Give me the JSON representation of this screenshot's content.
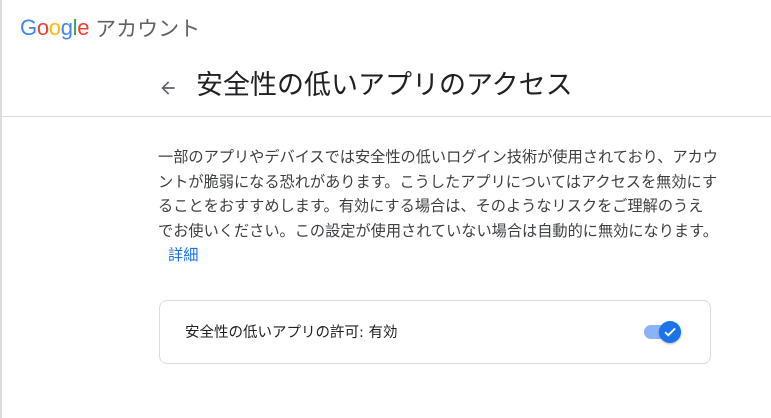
{
  "brand": {
    "letters": [
      {
        "char": "G",
        "color": "#4285F4"
      },
      {
        "char": "o",
        "color": "#EA4335"
      },
      {
        "char": "o",
        "color": "#FBBC05"
      },
      {
        "char": "g",
        "color": "#4285F4"
      },
      {
        "char": "l",
        "color": "#34A853"
      },
      {
        "char": "e",
        "color": "#EA4335"
      }
    ],
    "product": "アカウント"
  },
  "header": {
    "back_icon": "arrow-back-icon",
    "title": "安全性の低いアプリのアクセス"
  },
  "description": {
    "text": "一部のアプリやデバイスでは安全性の低いログイン技術が使用されており、アカウントが脆弱になる恐れがあります。こうしたアプリについてはアクセスを無効にすることをおすすめします。有効にする場合は、そのようなリスクをご理解のうえでお使いください。この設定が使用されていない場合は自動的に無効になります。",
    "link": "詳細"
  },
  "setting": {
    "label": "安全性の低いアプリの許可: 有効",
    "enabled": true,
    "check_icon": "check-icon"
  },
  "colors": {
    "accent": "#1a73e8",
    "track": "#8ab4f8",
    "divider": "#dadce0"
  }
}
